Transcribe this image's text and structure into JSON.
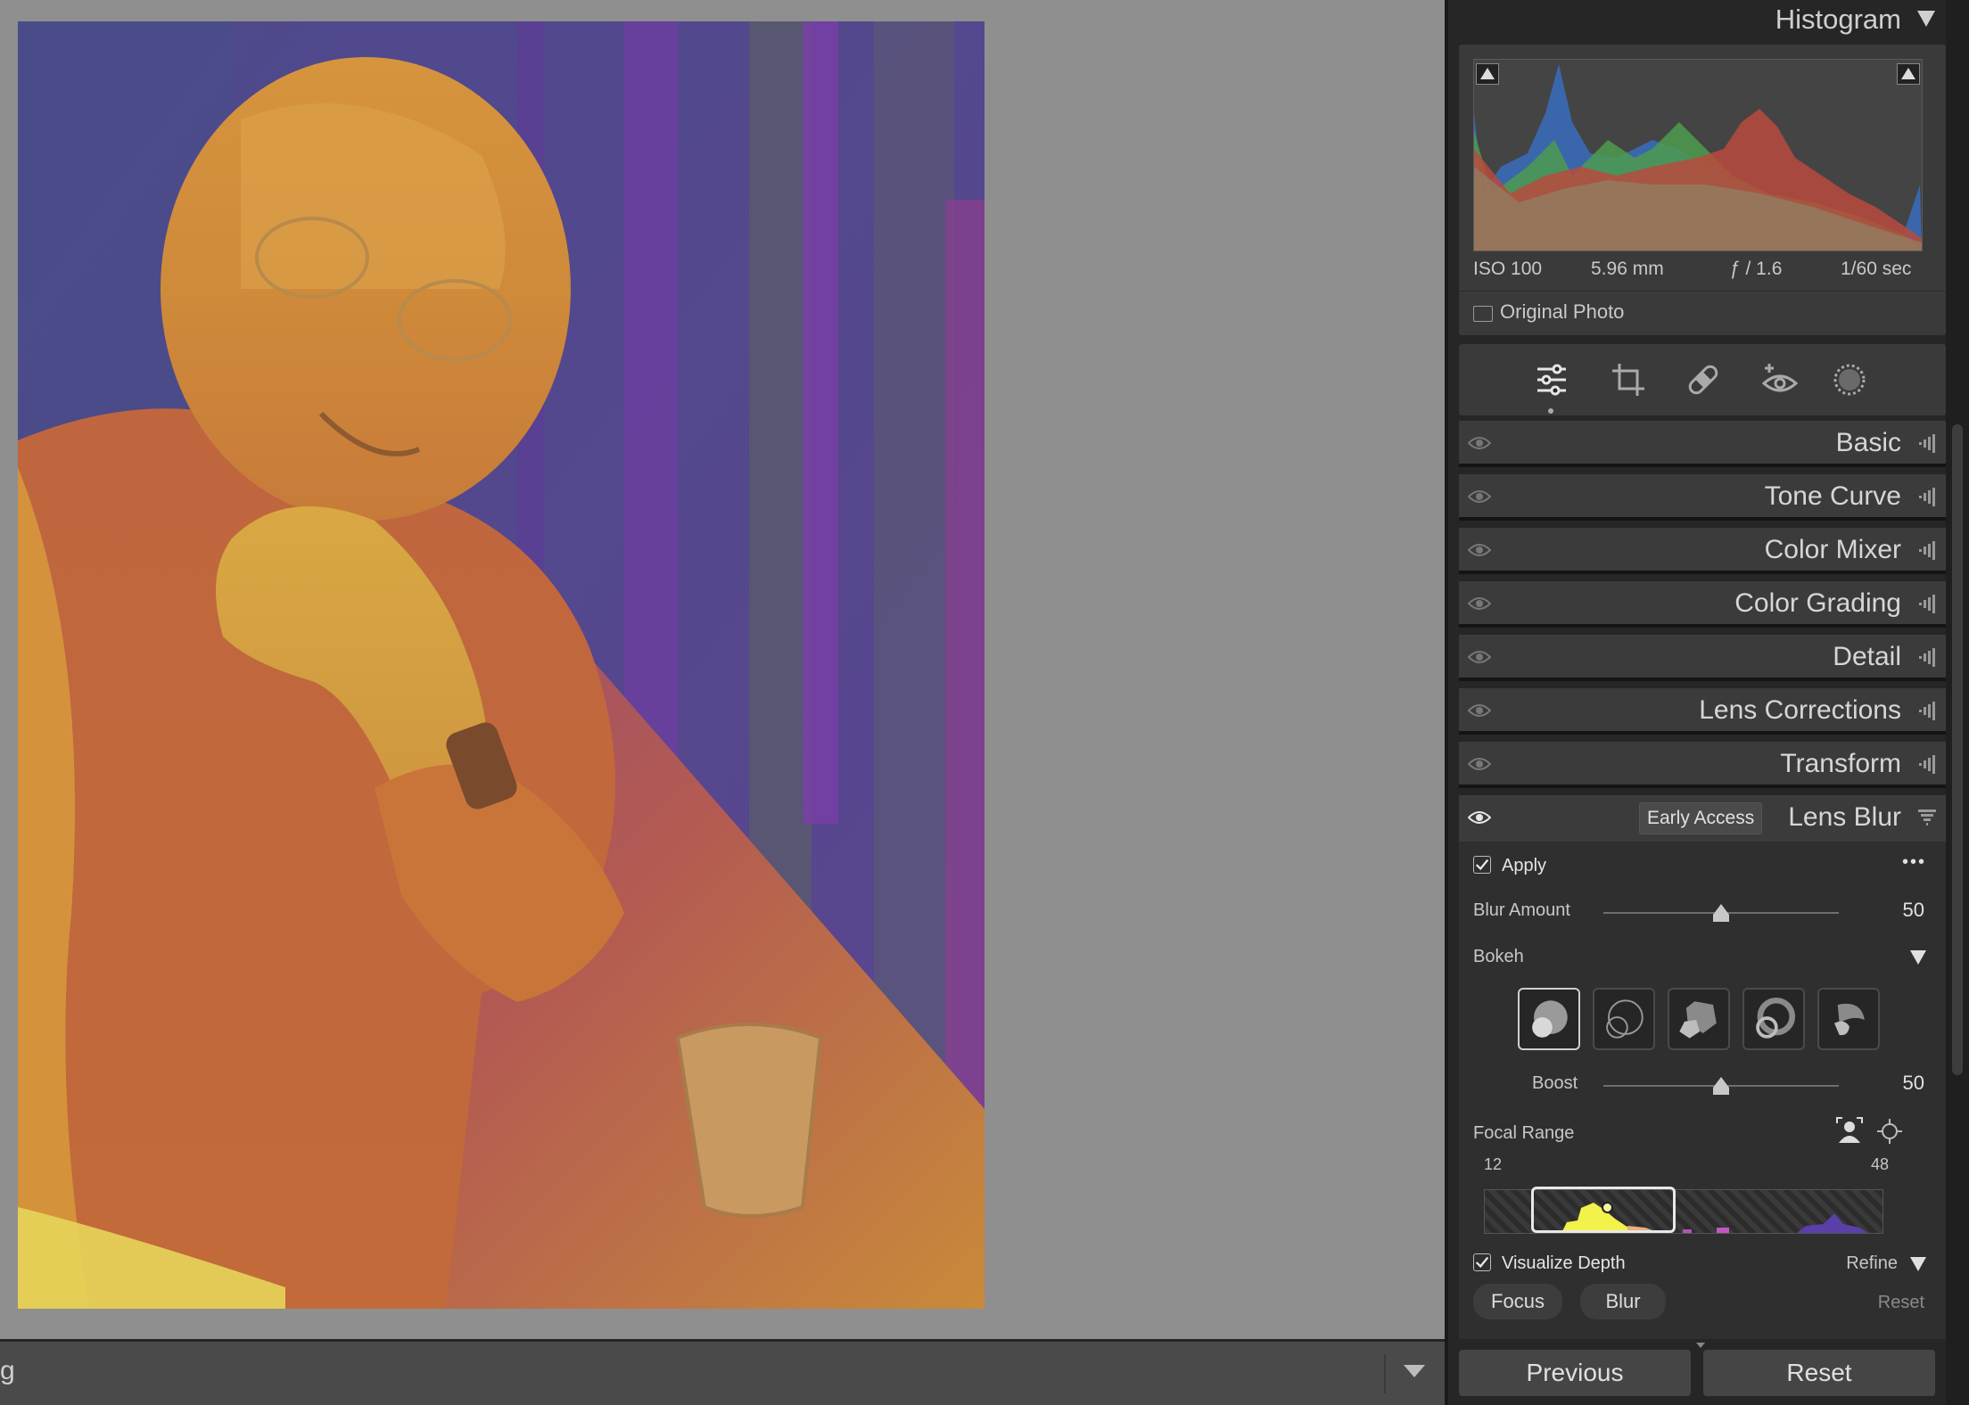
{
  "canvas": {
    "filmstrip_text": "g"
  },
  "histogram": {
    "title": "Histogram",
    "exif": {
      "iso": "ISO 100",
      "focal": "5.96 mm",
      "aperture": "ƒ / 1.6",
      "shutter": "1/60 sec"
    },
    "original_photo_label": "Original Photo"
  },
  "tools": [
    "edit-sliders-icon",
    "crop-icon",
    "healing-bandaid-icon",
    "redeye-icon",
    "masking-icon"
  ],
  "sections": [
    {
      "title": "Basic"
    },
    {
      "title": "Tone Curve"
    },
    {
      "title": "Color Mixer"
    },
    {
      "title": "Color Grading"
    },
    {
      "title": "Detail"
    },
    {
      "title": "Lens Corrections"
    },
    {
      "title": "Transform"
    }
  ],
  "lens_blur": {
    "badge": "Early Access",
    "title": "Lens Blur",
    "apply_label": "Apply",
    "more_label": "•••",
    "blur_amount_label": "Blur Amount",
    "blur_amount_value": "50",
    "blur_amount_fraction": 0.5,
    "bokeh_label": "Bokeh",
    "boost_label": "Boost",
    "boost_value": "50",
    "boost_fraction": 0.5,
    "focal_range_label": "Focal Range",
    "focal_min": "12",
    "focal_max": "48",
    "visualize_depth_label": "Visualize Depth",
    "refine_label": "Refine",
    "focus_button": "Focus",
    "blur_button": "Blur",
    "reset_link": "Reset"
  },
  "footer": {
    "previous": "Previous",
    "reset": "Reset"
  },
  "colors": {
    "panel_bg": "#262626",
    "section_bg": "#3b3b3b",
    "depth_near": "#f2f24a",
    "depth_far": "#5a3fa8"
  }
}
